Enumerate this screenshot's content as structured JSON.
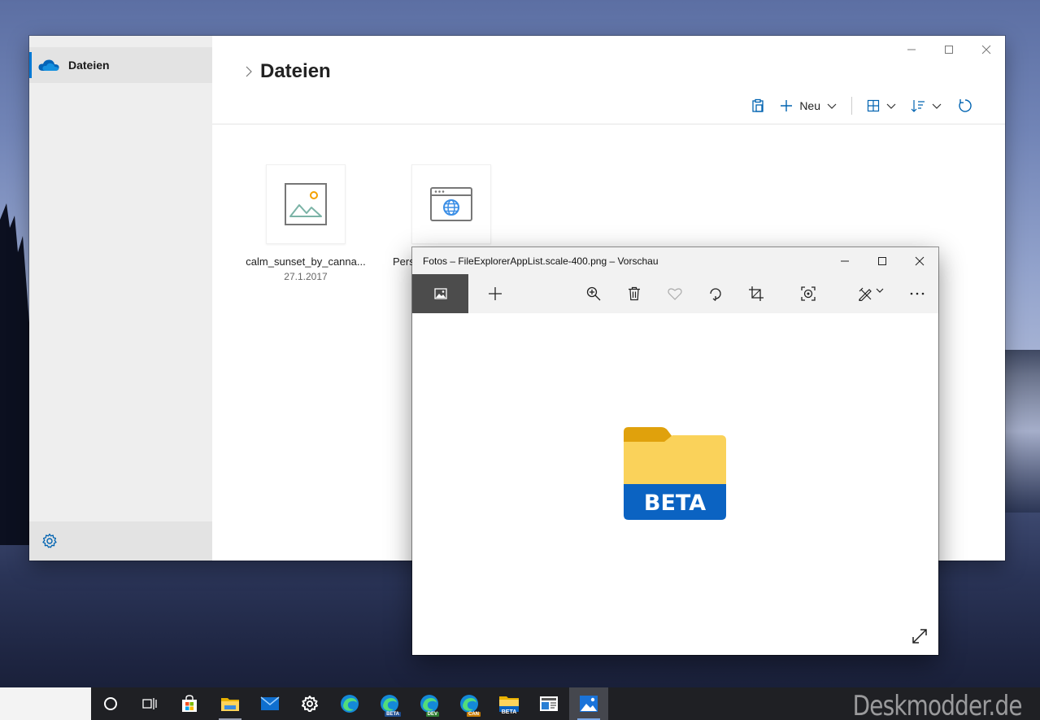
{
  "explorer": {
    "sidebar": {
      "active_item": "Dateien"
    },
    "breadcrumb": {
      "title": "Dateien"
    },
    "toolbar": {
      "new_label": "Neu"
    },
    "files": [
      {
        "name": "calm_sunset_by_canna...",
        "date": "27.1.2017",
        "icon": "image-file-icon"
      },
      {
        "name": "Pers",
        "date": "",
        "icon": "web-file-icon"
      }
    ]
  },
  "photos": {
    "title": "Fotos – FileExplorerAppList.scale-400.png – Vorschau",
    "image": {
      "badge_text": "BETA",
      "icon": "folder-beta-icon"
    },
    "colors": {
      "folder_yellow": "#fad25a",
      "folder_tab": "#e0a10c",
      "beta_blue": "#0b63c2"
    }
  },
  "taskbar": {
    "badges": {
      "edge_beta": "BETA",
      "edge_dev": "DEV",
      "edge_canary": "CAN",
      "explorer_beta": "BETA"
    }
  },
  "watermark": "Deskmodder.de"
}
